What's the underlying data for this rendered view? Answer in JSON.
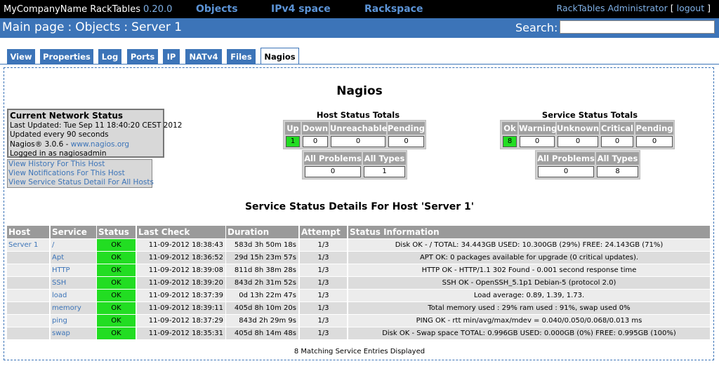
{
  "app": {
    "name": "MyCompanyName RackTables",
    "version": "0.20.0"
  },
  "topnav": [
    "Objects",
    "IPv4 space",
    "Rackspace"
  ],
  "user": {
    "name": "RackTables Administrator",
    "open_bracket": "[",
    "logout": "logout",
    "close_bracket": "]"
  },
  "breadcrumb": [
    "Main page",
    "Objects",
    "Server 1"
  ],
  "breadcrumb_sep": ":",
  "search": {
    "label": "Search:",
    "value": ""
  },
  "tabs": [
    "View",
    "Properties",
    "Log",
    "Ports",
    "IP",
    "NATv4",
    "Files",
    "Nagios"
  ],
  "active_tab": "Nagios",
  "nagios": {
    "title": "Nagios",
    "network_status": {
      "title": "Current Network Status",
      "updated": "Last Updated: Tue Sep 11 18:40:20 CEST 2012",
      "interval": "Updated every 90 seconds",
      "version_prefix": "Nagios® 3.0.6 - ",
      "version_link": "www.nagios.org",
      "logged_in": "Logged in as nagiosadmin"
    },
    "links": [
      "View History For This Host",
      "View Notifications For This Host",
      "View Service Status Detail For All Hosts"
    ],
    "host_totals": {
      "title": "Host Status Totals",
      "headers": [
        "Up",
        "Down",
        "Unreachable",
        "Pending"
      ],
      "values": [
        "1",
        "0",
        "0",
        "0"
      ],
      "sum_headers": [
        "All Problems",
        "All Types"
      ],
      "sum_values": [
        "0",
        "1"
      ]
    },
    "service_totals": {
      "title": "Service Status Totals",
      "headers": [
        "Ok",
        "Warning",
        "Unknown",
        "Critical",
        "Pending"
      ],
      "values": [
        "8",
        "0",
        "0",
        "0",
        "0"
      ],
      "sum_headers": [
        "All Problems",
        "All Types"
      ],
      "sum_values": [
        "0",
        "8"
      ]
    },
    "details_title": "Service Status Details For Host 'Server 1'",
    "columns": [
      "Host",
      "Service",
      "Status",
      "Last Check",
      "Duration",
      "Attempt",
      "Status Information"
    ],
    "rows": [
      {
        "host": "Server 1",
        "service": "/",
        "status": "OK",
        "last_check": "11-09-2012 18:38:43",
        "duration": "583d 3h 50m 18s",
        "attempt": "1/3",
        "info": "Disk OK - / TOTAL: 34.443GB USED: 10.300GB (29%) FREE: 24.143GB (71%)"
      },
      {
        "host": "",
        "service": "Apt",
        "status": "OK",
        "last_check": "11-09-2012 18:36:52",
        "duration": "29d 15h 23m 57s",
        "attempt": "1/3",
        "info": "APT OK: 0 packages available for upgrade (0 critical updates)."
      },
      {
        "host": "",
        "service": "HTTP",
        "status": "OK",
        "last_check": "11-09-2012 18:39:08",
        "duration": "811d 8h 38m 28s",
        "attempt": "1/3",
        "info": "HTTP OK - HTTP/1.1 302 Found - 0.001 second response time"
      },
      {
        "host": "",
        "service": "SSH",
        "status": "OK",
        "last_check": "11-09-2012 18:39:20",
        "duration": "843d 2h 31m 52s",
        "attempt": "1/3",
        "info": "SSH OK - OpenSSH_5.1p1 Debian-5 (protocol 2.0)"
      },
      {
        "host": "",
        "service": "load",
        "status": "OK",
        "last_check": "11-09-2012 18:37:39",
        "duration": "0d 13h 22m 47s",
        "attempt": "1/3",
        "info": "Load average: 0.89, 1.39, 1.73."
      },
      {
        "host": "",
        "service": "memory",
        "status": "OK",
        "last_check": "11-09-2012 18:39:11",
        "duration": "405d 8h 10m 20s",
        "attempt": "1/3",
        "info": "Total memory used : 29% ram used : 91%, swap used 0%"
      },
      {
        "host": "",
        "service": "ping",
        "status": "OK",
        "last_check": "11-09-2012 18:37:29",
        "duration": "843d 2h 29m 9s",
        "attempt": "1/3",
        "info": "PING OK - rtt min/avg/max/mdev = 0.040/0.050/0.068/0.013 ms"
      },
      {
        "host": "",
        "service": "swap",
        "status": "OK",
        "last_check": "11-09-2012 18:35:31",
        "duration": "405d 8h 14m 48s",
        "attempt": "1/3",
        "info": "Disk OK - Swap space TOTAL: 0.996GB USED: 0.000GB (0%) FREE: 0.995GB (100%)"
      }
    ],
    "footer": "8 Matching Service Entries Displayed"
  },
  "colors": {
    "brand_blue": "#3c74b8",
    "ok_green": "#22dd22",
    "header_gray": "#9a9a9a"
  }
}
